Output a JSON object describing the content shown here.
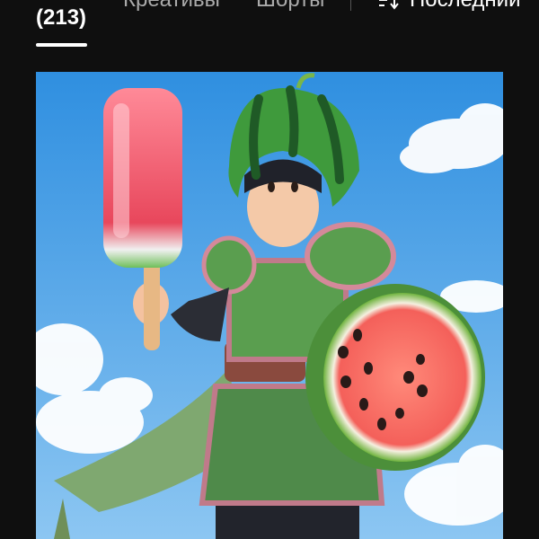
{
  "tabs": {
    "active_count": "(213)",
    "creatives_label": "Креативы",
    "shorts_label": "Шорты"
  },
  "sort": {
    "label": "Последний",
    "icon": "sort-icon"
  },
  "thumbnail": {
    "subject": "watermelon-warrior-illustration"
  },
  "colors": {
    "background": "#0f0f0f",
    "text_primary": "#ffffff",
    "text_secondary": "#aaaaaa"
  }
}
